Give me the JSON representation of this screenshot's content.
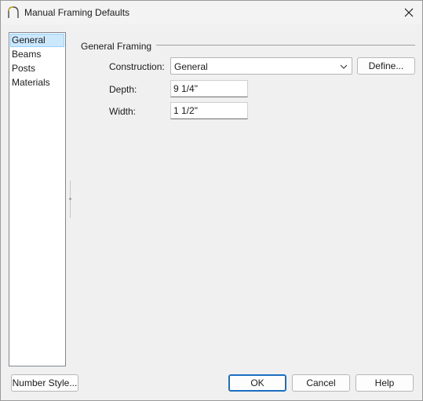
{
  "window": {
    "title": "Manual Framing Defaults",
    "app_icon": "chief-architect-arch-icon",
    "close_icon": "close-icon"
  },
  "nav": {
    "items": [
      {
        "label": "General",
        "selected": true
      },
      {
        "label": "Beams",
        "selected": false
      },
      {
        "label": "Posts",
        "selected": false
      },
      {
        "label": "Materials",
        "selected": false
      }
    ]
  },
  "general_framing": {
    "group_title": "General Framing",
    "construction_label": "Construction:",
    "construction_value": "General",
    "define_button": "Define...",
    "depth_label": "Depth:",
    "depth_value": "9 1/4\"",
    "width_label": "Width:",
    "width_value": "1 1/2\""
  },
  "footer": {
    "number_style_button": "Number Style...",
    "ok_button": "OK",
    "cancel_button": "Cancel",
    "help_button": "Help"
  },
  "colors": {
    "selection_bg": "#cce8ff",
    "default_button_border": "#1a6ec2",
    "dialog_bg": "#f0f0f0"
  }
}
